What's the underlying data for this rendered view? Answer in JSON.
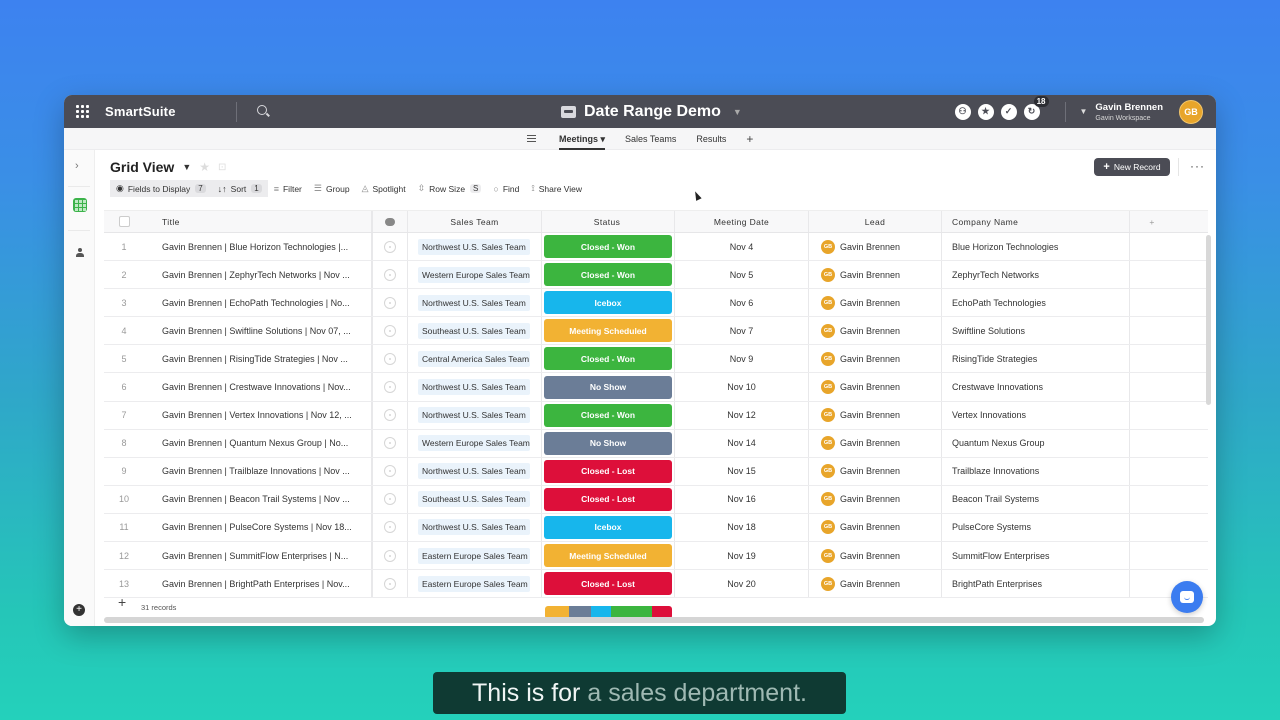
{
  "app": {
    "brand": "SmartSuite",
    "solution_title": "Date Range Demo",
    "notifications_count": "18",
    "user": {
      "name": "Gavin Brennen",
      "workspace": "Gavin Workspace",
      "initials": "GB"
    }
  },
  "tabs": [
    {
      "label": "Meetings ▾",
      "active": true
    },
    {
      "label": "Sales Teams",
      "active": false
    },
    {
      "label": "Results",
      "active": false
    }
  ],
  "tab_add": "+",
  "view": {
    "title": "Grid View",
    "new_record_label": "New Record",
    "more_label": "···"
  },
  "toolbar": {
    "fields": {
      "label": "Fields to Display",
      "count": "7"
    },
    "sort": {
      "label": "Sort",
      "count": "1"
    },
    "filter": {
      "label": "Filter"
    },
    "group": {
      "label": "Group"
    },
    "spotlight": {
      "label": "Spotlight"
    },
    "row_size": {
      "label": "Row Size",
      "value": "S"
    },
    "find": {
      "label": "Find"
    },
    "share": {
      "label": "Share View"
    }
  },
  "columns": {
    "title": "Title",
    "sales_team": "Sales Team",
    "status": "Status",
    "meeting_date": "Meeting Date",
    "lead": "Lead",
    "company": "Company Name",
    "add": "+"
  },
  "status_colors": {
    "Closed - Won": "#3cb53f",
    "Icebox": "#17b6ec",
    "Meeting Scheduled": "#f2b233",
    "No Show": "#6b7d97",
    "Closed - Lost": "#dd0f3a"
  },
  "rows": [
    {
      "num": "1",
      "title": "Gavin Brennen | Blue Horizon Technologies |...",
      "team": "Northwest U.S. Sales Team",
      "status": "Closed - Won",
      "date": "Nov 4",
      "lead": "Gavin Brennen",
      "company": "Blue Horizon Technologies"
    },
    {
      "num": "2",
      "title": "Gavin Brennen | ZephyrTech Networks | Nov ...",
      "team": "Western Europe Sales Team",
      "status": "Closed - Won",
      "date": "Nov 5",
      "lead": "Gavin Brennen",
      "company": "ZephyrTech Networks"
    },
    {
      "num": "3",
      "title": "Gavin Brennen | EchoPath Technologies | No...",
      "team": "Northwest U.S. Sales Team",
      "status": "Icebox",
      "date": "Nov 6",
      "lead": "Gavin Brennen",
      "company": "EchoPath Technologies"
    },
    {
      "num": "4",
      "title": "Gavin Brennen | Swiftline Solutions | Nov 07, ...",
      "team": "Southeast U.S. Sales Team",
      "status": "Meeting Scheduled",
      "date": "Nov 7",
      "lead": "Gavin Brennen",
      "company": "Swiftline Solutions"
    },
    {
      "num": "5",
      "title": "Gavin Brennen | RisingTide Strategies | Nov ...",
      "team": "Central America Sales Team",
      "status": "Closed - Won",
      "date": "Nov 9",
      "lead": "Gavin Brennen",
      "company": "RisingTide Strategies"
    },
    {
      "num": "6",
      "title": "Gavin Brennen | Crestwave Innovations | Nov...",
      "team": "Northwest U.S. Sales Team",
      "status": "No Show",
      "date": "Nov 10",
      "lead": "Gavin Brennen",
      "company": "Crestwave Innovations"
    },
    {
      "num": "7",
      "title": "Gavin Brennen | Vertex Innovations | Nov 12, ...",
      "team": "Northwest U.S. Sales Team",
      "status": "Closed - Won",
      "date": "Nov 12",
      "lead": "Gavin Brennen",
      "company": "Vertex Innovations"
    },
    {
      "num": "8",
      "title": "Gavin Brennen | Quantum Nexus Group | No...",
      "team": "Western Europe Sales Team",
      "status": "No Show",
      "date": "Nov 14",
      "lead": "Gavin Brennen",
      "company": "Quantum Nexus Group"
    },
    {
      "num": "9",
      "title": "Gavin Brennen | Trailblaze Innovations | Nov ...",
      "team": "Northwest U.S. Sales Team",
      "status": "Closed - Lost",
      "date": "Nov 15",
      "lead": "Gavin Brennen",
      "company": "Trailblaze Innovations"
    },
    {
      "num": "10",
      "title": "Gavin Brennen | Beacon Trail Systems | Nov ...",
      "team": "Southeast U.S. Sales Team",
      "status": "Closed - Lost",
      "date": "Nov 16",
      "lead": "Gavin Brennen",
      "company": "Beacon Trail Systems"
    },
    {
      "num": "11",
      "title": "Gavin Brennen | PulseCore Systems | Nov 18...",
      "team": "Northwest U.S. Sales Team",
      "status": "Icebox",
      "date": "Nov 18",
      "lead": "Gavin Brennen",
      "company": "PulseCore Systems"
    },
    {
      "num": "12",
      "title": "Gavin Brennen | SummitFlow Enterprises | N...",
      "team": "Eastern Europe Sales Team",
      "status": "Meeting Scheduled",
      "date": "Nov 19",
      "lead": "Gavin Brennen",
      "company": "SummitFlow Enterprises"
    },
    {
      "num": "13",
      "title": "Gavin Brennen | BrightPath Enterprises | Nov...",
      "team": "Eastern Europe Sales Team",
      "status": "Closed - Lost",
      "date": "Nov 20",
      "lead": "Gavin Brennen",
      "company": "BrightPath Enterprises"
    }
  ],
  "footer": {
    "records_label": "31 records",
    "status_summary": [
      {
        "status": "Meeting Scheduled",
        "fraction": 0.19
      },
      {
        "status": "No Show",
        "fraction": 0.17
      },
      {
        "status": "Icebox",
        "fraction": 0.16
      },
      {
        "status": "Closed - Won",
        "fraction": 0.32
      },
      {
        "status": "Closed - Lost",
        "fraction": 0.16
      }
    ]
  },
  "caption": {
    "part1": "This is for",
    "part2": "a sales department."
  }
}
